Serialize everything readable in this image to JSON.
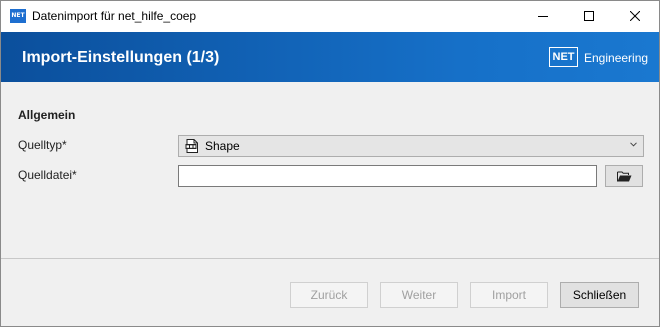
{
  "window": {
    "app_icon_text": "NET",
    "title": "Datenimport für net_hilfe_coep"
  },
  "header": {
    "title": "Import-Einstellungen (1/3)",
    "brand_box": "NET",
    "brand_text": "Engineering",
    "gradient_colors": [
      "#0b4f9c",
      "#1a78d0"
    ]
  },
  "form": {
    "section_title": "Allgemein",
    "source_type": {
      "label": "Quelltyp*",
      "selected": "Shape",
      "icon": "shape-file-icon"
    },
    "source_file": {
      "label": "Quelldatei*",
      "value": "",
      "browse_icon": "folder-open-icon"
    }
  },
  "footer": {
    "back_label": "Zurück",
    "next_label": "Weiter",
    "import_label": "Import",
    "close_label": "Schließen"
  }
}
